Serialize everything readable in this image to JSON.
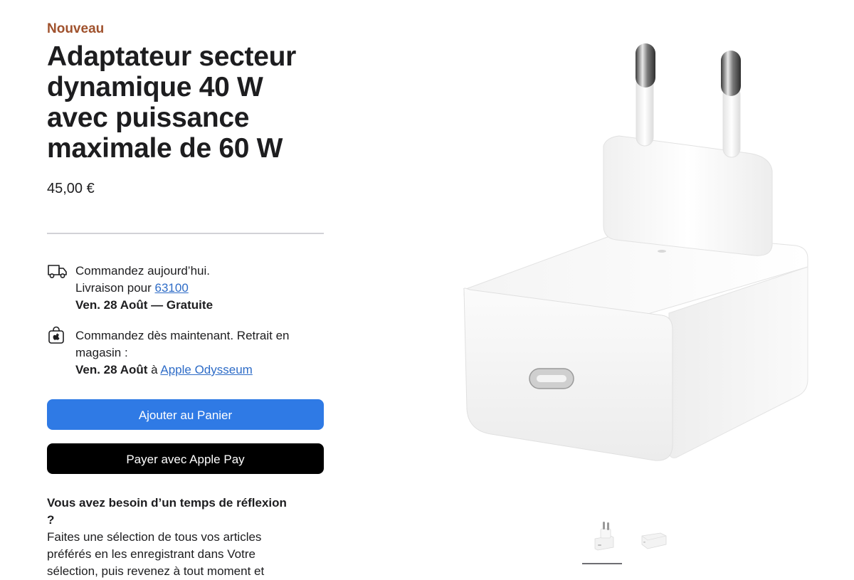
{
  "product": {
    "badge": "Nouveau",
    "title": "Adaptateur secteur dynamique 40 W avec puissance maximale de 60 W",
    "price": "45,00 €"
  },
  "delivery": {
    "icon": "delivery-truck-icon",
    "line1": "Commandez aujourd’hui.",
    "line2_prefix": "Livraison pour ",
    "postal_code": "63100",
    "line3": "Ven. 28 Août — Gratuite"
  },
  "pickup": {
    "icon": "apple-bag-icon",
    "line1": "Commandez dès maintenant. Retrait en magasin :",
    "date": "Ven. 28 Août",
    "connector": " à ",
    "store": "Apple Odysseum"
  },
  "buttons": {
    "add_to_cart": "Ajouter au Panier",
    "apple_pay": "Payer avec Apple Pay"
  },
  "reflection": {
    "heading": "Vous avez besoin d’un temps de réflexion ?",
    "body": "Faites une sélection de tous vos articles préférés en les enregistrant dans Votre sélection, puis revenez à tout moment et"
  },
  "gallery": {
    "thumbnails": [
      "power-adapter-plug-view",
      "power-adapter-flat-view"
    ],
    "selected_index": 0
  },
  "colors": {
    "badge": "#a0522d",
    "primary_button": "#2f7ae5",
    "pay_button": "#000000",
    "link": "#2e6cc7"
  }
}
